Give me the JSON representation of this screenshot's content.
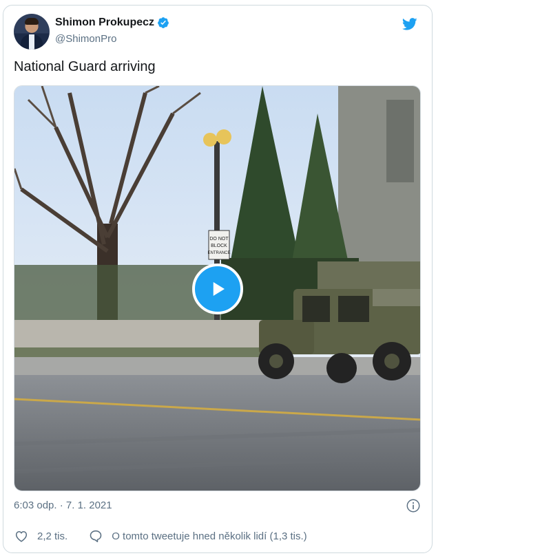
{
  "tweet": {
    "display_name": "Shimon Prokupecz",
    "handle": "@ShimonPro",
    "text": "National Guard arriving",
    "timestamp": "6:03 odp. · 7. 1. 2021",
    "likes": "2,2 tis.",
    "conversation": "O tomto tweetuje hned několik lidí (1,3 tis.)"
  },
  "media": {
    "sign_lines": [
      "DO NOT",
      "BLOCK",
      "ENTRANCE"
    ]
  },
  "icons": {
    "verified": "verified-badge-icon",
    "brand": "twitter-bird-icon",
    "play": "play-icon",
    "info": "info-icon",
    "like": "heart-icon",
    "reply": "speech-bubble-icon"
  },
  "colors": {
    "accent": "#1da1f2",
    "secondary_text": "#5b7083",
    "border": "#cfd9de"
  }
}
